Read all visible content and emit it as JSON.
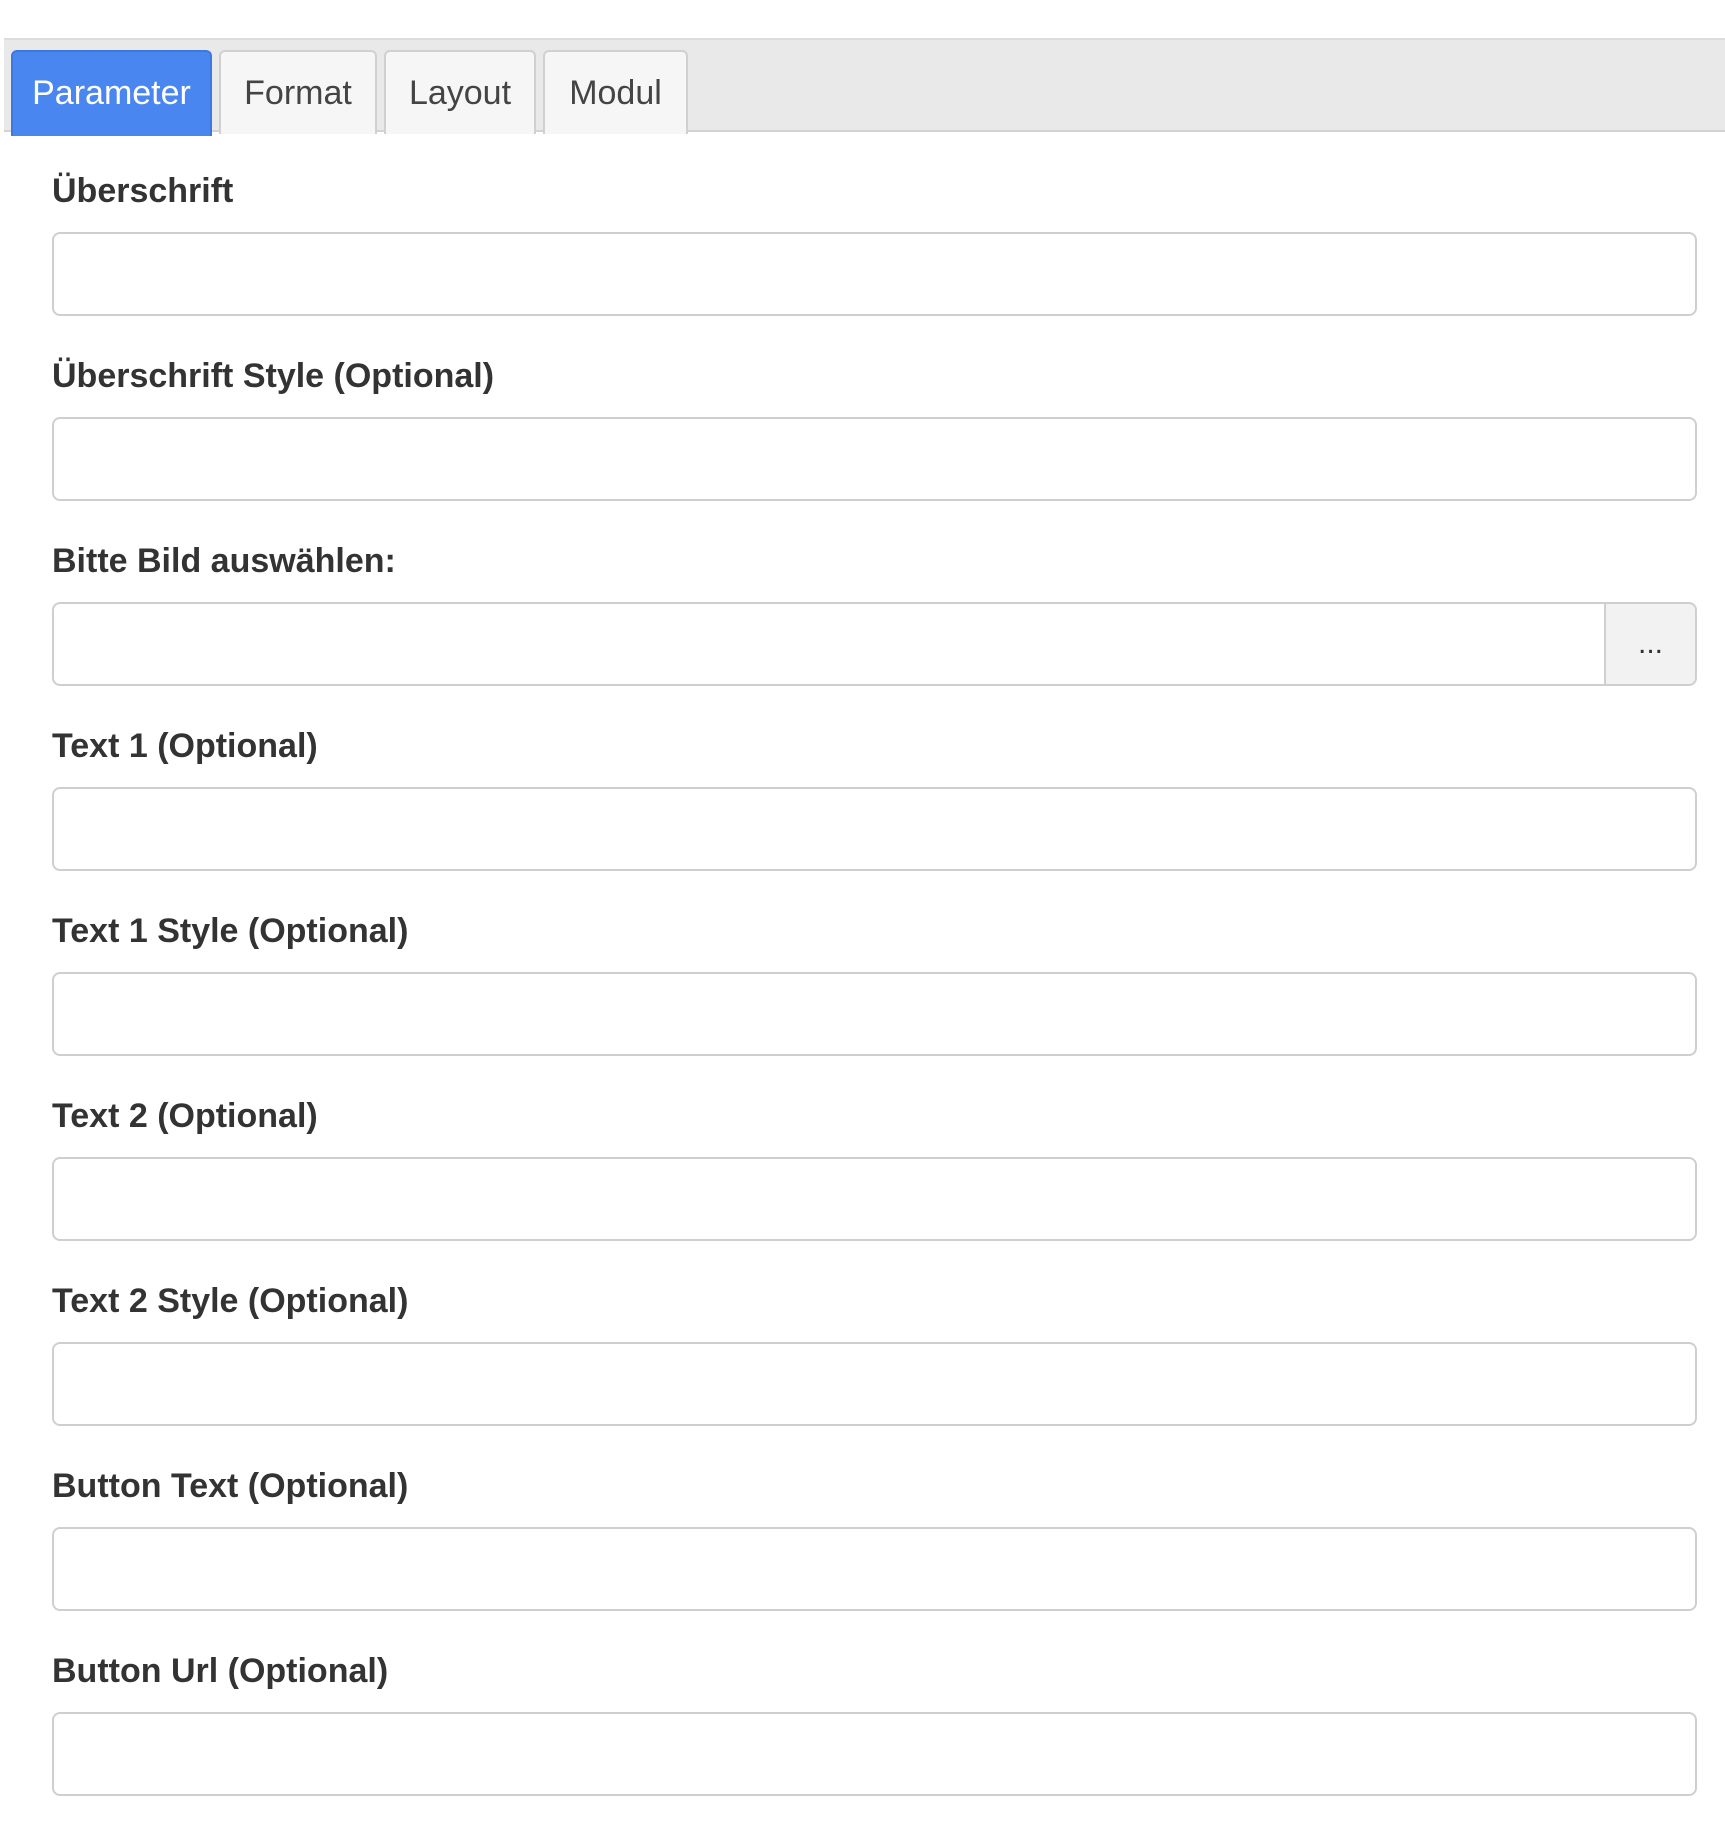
{
  "tabs": [
    {
      "label": "Parameter",
      "active": true
    },
    {
      "label": "Format",
      "active": false
    },
    {
      "label": "Layout",
      "active": false
    },
    {
      "label": "Modul",
      "active": false
    }
  ],
  "fields": [
    {
      "label": "Überschrift",
      "value": "",
      "placeholder": ""
    },
    {
      "label": "Überschrift Style (Optional)",
      "value": "",
      "placeholder": ""
    },
    {
      "label": "Bitte Bild auswählen:",
      "value": "",
      "placeholder": "",
      "button_label": "..."
    },
    {
      "label": "Text 1 (Optional)",
      "value": "",
      "placeholder": ""
    },
    {
      "label": "Text 1 Style (Optional)",
      "value": "",
      "placeholder": ""
    },
    {
      "label": "Text 2 (Optional)",
      "value": "",
      "placeholder": ""
    },
    {
      "label": "Text 2 Style (Optional)",
      "value": "",
      "placeholder": ""
    },
    {
      "label": "Button Text (Optional)",
      "value": "",
      "placeholder": ""
    },
    {
      "label": "Button Url (Optional)",
      "value": "",
      "placeholder": ""
    }
  ],
  "colors": {
    "accent": "#4a86f0",
    "tabbar_bg": "#e9e9e9",
    "border": "#cfcfcf"
  }
}
